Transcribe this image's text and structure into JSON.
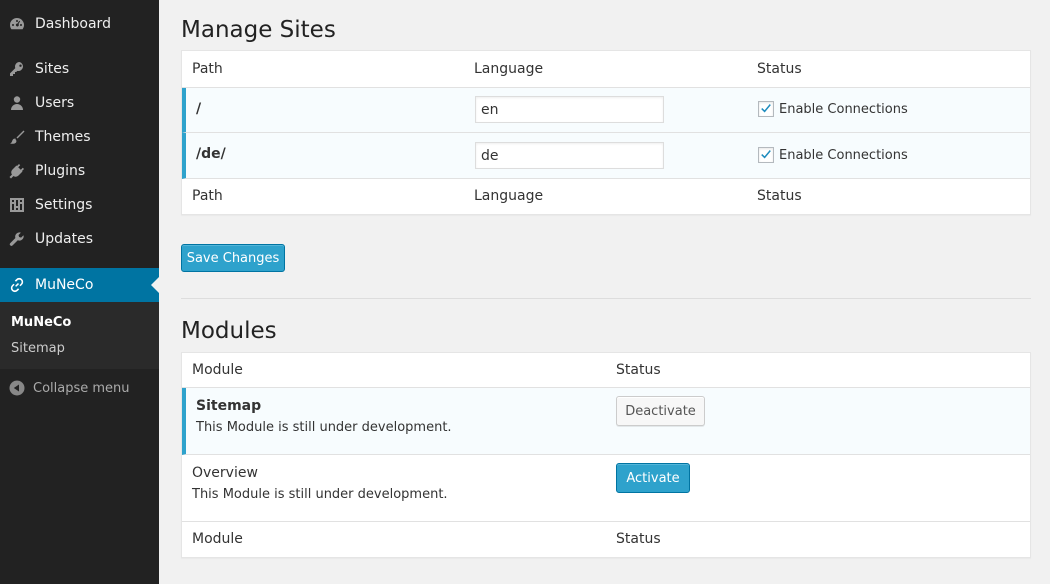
{
  "sidebar": {
    "items": [
      {
        "label": "Dashboard",
        "icon": "dashboard-icon"
      },
      {
        "label": "Sites",
        "icon": "key-icon"
      },
      {
        "label": "Users",
        "icon": "user-icon"
      },
      {
        "label": "Themes",
        "icon": "brush-icon"
      },
      {
        "label": "Plugins",
        "icon": "plug-icon"
      },
      {
        "label": "Settings",
        "icon": "sliders-icon"
      },
      {
        "label": "Updates",
        "icon": "wrench-icon"
      },
      {
        "label": "MuNeCo",
        "icon": "link-icon"
      }
    ],
    "submenu": [
      {
        "label": "MuNeCo"
      },
      {
        "label": "Sitemap"
      }
    ],
    "collapse_label": "Collapse menu",
    "accent": "#0074a2"
  },
  "sites": {
    "title": "Manage Sites",
    "headers": {
      "path": "Path",
      "language": "Language",
      "status": "Status"
    },
    "rows": [
      {
        "path": "/",
        "language": "en",
        "status_label": "Enable Connections",
        "checked": true
      },
      {
        "path": "/de/",
        "language": "de",
        "status_label": "Enable Connections",
        "checked": true
      }
    ],
    "save_label": "Save Changes"
  },
  "modules": {
    "title": "Modules",
    "headers": {
      "module": "Module",
      "status": "Status"
    },
    "rows": [
      {
        "name": "Sitemap",
        "desc": "This Module is still under development.",
        "action": "Deactivate"
      },
      {
        "name": "Overview",
        "desc": "This Module is still under development.",
        "action": "Activate"
      }
    ]
  }
}
